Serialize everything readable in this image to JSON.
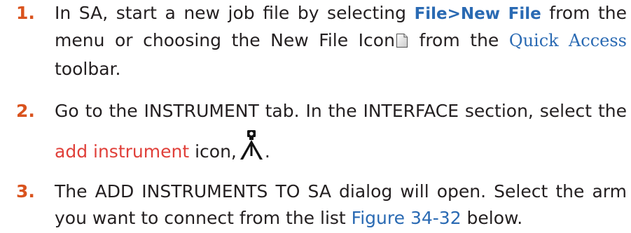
{
  "steps": [
    {
      "number": "1.",
      "seg1": "In SA, start a new job file by selecting",
      "menu_path": "File>New File",
      "seg2": "from the menu or choosing the New File Icon",
      "seg3": "from the",
      "quick_access": "Quick Access",
      "seg4": "toolbar."
    },
    {
      "number": "2.",
      "seg1": "Go to the INSTRUMENT tab. In the INTERFACE section, select the",
      "link": "add instrument",
      "seg2": "icon,",
      "seg3": "."
    },
    {
      "number": "3.",
      "seg1": "The ADD INSTRUMENTS TO SA dialog will open.  Select the arm you want to connect from the list",
      "figure_ref": "Figure 34-32",
      "seg2": "below."
    }
  ],
  "colors": {
    "number": "#d9531e",
    "menu_path": "#2a6ab3",
    "link_red": "#e0403a",
    "figure_ref": "#2a6ab3"
  },
  "icons": {
    "new_file": "new-file-icon",
    "add_instrument": "tripod-instrument-icon"
  }
}
